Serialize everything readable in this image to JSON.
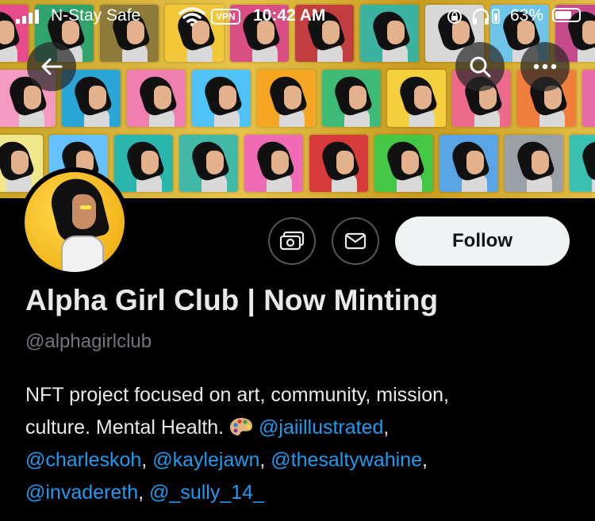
{
  "status_bar": {
    "carrier": "N-Stay Safe",
    "vpn": "VPN",
    "time": "10:42 AM",
    "battery": "63%"
  },
  "banner": {
    "rows": [
      [
        "#e84b8a",
        "#2fa36b",
        "#8e7a3a",
        "#f2c83a",
        "#d94f83",
        "#c23d3d",
        "#3bb3a0",
        "#d7d7d7",
        "#6ec5e9",
        "#c54b8c"
      ],
      [
        "#f49ac1",
        "#2aa6d6",
        "#f07fb0",
        "#4fc3f7",
        "#f6a623",
        "#3dbb77",
        "#f4d03f",
        "#ec6a8c",
        "#f07e3c",
        "#e86aa8"
      ],
      [
        "#f0e68c",
        "#66c2ff",
        "#2ab6ad",
        "#42b9a6",
        "#f06bb5",
        "#d63a3a",
        "#44c744",
        "#5aa5e6",
        "#9aa0a6",
        "#3ac0b0"
      ]
    ]
  },
  "profile": {
    "name": "Alpha Girl Club | Now Minting",
    "handle": "@alphagirlclub",
    "follow_label": "Follow",
    "bio": {
      "line1": "NFT project focused on art, community, mission,",
      "line2_text": "culture. Mental Health.",
      "emoji": "palette-emoji",
      "mentions": {
        "jai": "@jaiillustrated",
        "charles": "@charleskoh",
        "kayle": "@kaylejawn",
        "salty": "@thesaltywahine",
        "invade": "@invadereth",
        "sully": "@_sully_14_"
      }
    }
  },
  "colors": {
    "background": "#000000",
    "mention": "#1d9bf0",
    "follow_bg": "#eff3f4",
    "secondary_text": "#71767b"
  }
}
